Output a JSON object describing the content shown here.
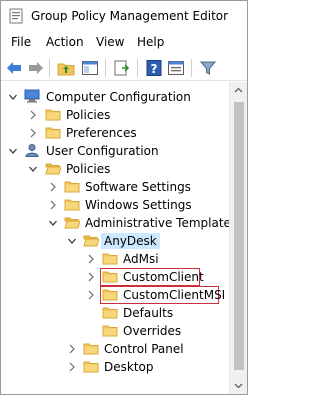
{
  "window": {
    "title": "Group Policy Management Editor"
  },
  "menu": {
    "file": "File",
    "action": "Action",
    "view": "View",
    "help": "Help"
  },
  "toolbar": {
    "icons": [
      "back-icon",
      "forward-icon",
      "up-folder-icon",
      "show-hide-tree-icon",
      "export-list-icon",
      "help-icon",
      "properties-icon",
      "filter-icon"
    ]
  },
  "tree": {
    "computer_configuration": "Computer Configuration",
    "cc_policies": "Policies",
    "cc_preferences": "Preferences",
    "user_configuration": "User Configuration",
    "uc_policies": "Policies",
    "software_settings": "Software Settings",
    "windows_settings": "Windows Settings",
    "administrative_templates": "Administrative Templates: P",
    "anydesk": "AnyDesk",
    "admsi": "AdMsi",
    "customclient": "CustomClient",
    "customclientmsi": "CustomClientMSI",
    "defaults": "Defaults",
    "overrides": "Overrides",
    "control_panel": "Control Panel",
    "desktop": "Desktop"
  },
  "colors": {
    "selection": "#cce8ff",
    "highlight_box": "#c8303a",
    "folder": "#f2c55c"
  }
}
